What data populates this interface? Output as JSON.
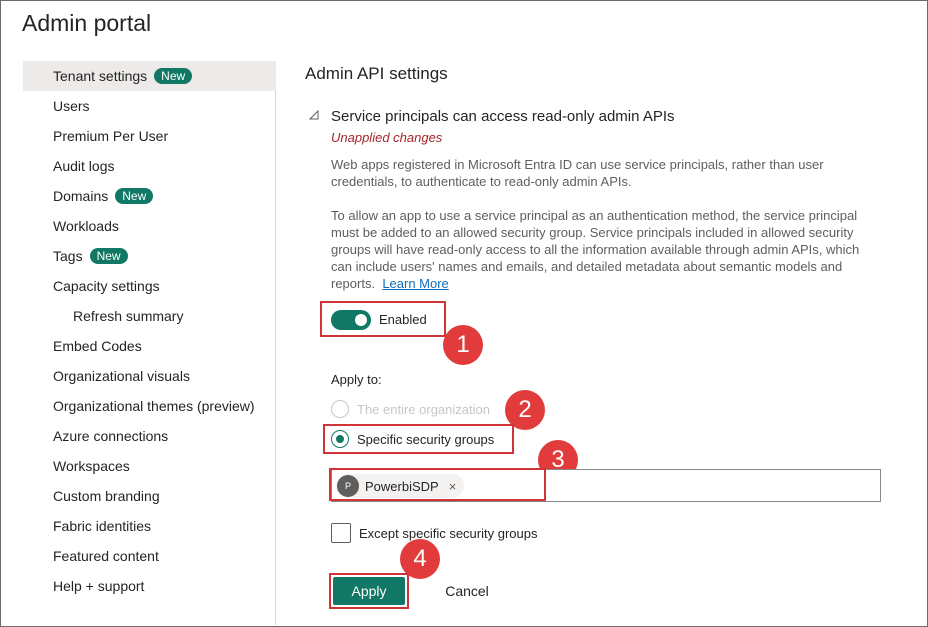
{
  "app": {
    "title": "Admin portal"
  },
  "sidebar": {
    "items": [
      {
        "label": "Tenant settings",
        "badge": "New",
        "active": true
      },
      {
        "label": "Users"
      },
      {
        "label": "Premium Per User"
      },
      {
        "label": "Audit logs"
      },
      {
        "label": "Domains",
        "badge": "New"
      },
      {
        "label": "Workloads"
      },
      {
        "label": "Tags",
        "badge": "New"
      },
      {
        "label": "Capacity settings"
      },
      {
        "label": "Refresh summary",
        "sub": true
      },
      {
        "label": "Embed Codes"
      },
      {
        "label": "Organizational visuals"
      },
      {
        "label": "Organizational themes (preview)"
      },
      {
        "label": "Azure connections"
      },
      {
        "label": "Workspaces"
      },
      {
        "label": "Custom branding"
      },
      {
        "label": "Fabric identities"
      },
      {
        "label": "Featured content"
      },
      {
        "label": "Help + support"
      }
    ]
  },
  "main": {
    "section_title": "Admin API settings",
    "setting": {
      "title": "Service principals can access read-only admin APIs",
      "status": "Unapplied changes",
      "description_1": "Web apps registered in Microsoft Entra ID can use service principals, rather than user credentials, to authenticate to read-only admin APIs.",
      "description_2": "To allow an app to use a service principal as an authentication method, the service principal must be added to an allowed security group. Service principals included in allowed security groups will have read-only access to all the information available through admin APIs, which can include users' names and emails, and detailed metadata about semantic models and reports.",
      "learn_more": "Learn More",
      "toggle_label": "Enabled",
      "toggle_on": true,
      "apply_to_label": "Apply to:",
      "options": [
        {
          "label": "The entire organization",
          "checked": false,
          "disabled": true
        },
        {
          "label": "Specific security groups",
          "checked": true,
          "disabled": false
        }
      ],
      "group_chip": {
        "initial": "P",
        "name": "PowerbiSDP",
        "remove": "×"
      },
      "except_label": "Except specific security groups",
      "apply_button": "Apply",
      "cancel_button": "Cancel"
    }
  },
  "annotations": {
    "markers": [
      "1",
      "2",
      "3",
      "4"
    ],
    "color": "#e23b3b"
  },
  "colors": {
    "accent": "#117865",
    "warning": "#a4262c",
    "highlight": "#d13438"
  }
}
